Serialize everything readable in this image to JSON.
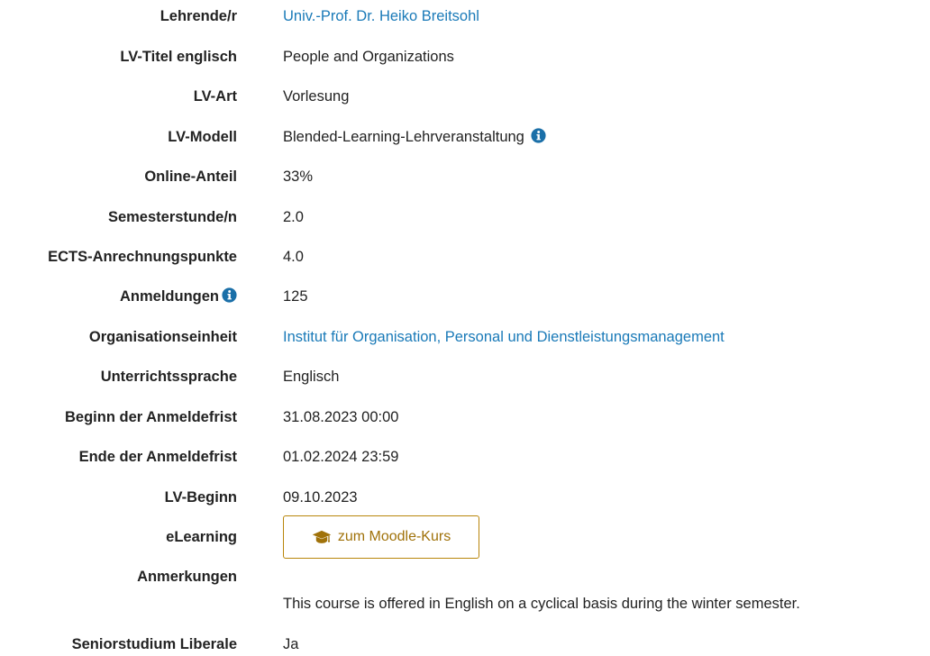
{
  "rows": {
    "lehrende": {
      "label": "Lehrende/r",
      "value": "Univ.-Prof. Dr. Heiko Breitsohl"
    },
    "titel_en": {
      "label": "LV-Titel englisch",
      "value": "People and Organizations"
    },
    "art": {
      "label": "LV-Art",
      "value": "Vorlesung"
    },
    "modell": {
      "label": "LV-Modell",
      "value": "Blended-Learning-Lehrveranstaltung"
    },
    "online": {
      "label": "Online-Anteil",
      "value": "33%"
    },
    "semesterstunden": {
      "label": "Semesterstunde/n",
      "value": "2.0"
    },
    "ects": {
      "label": "ECTS-Anrechnungspunkte",
      "value": "4.0"
    },
    "anmeldungen": {
      "label": "Anmeldungen",
      "value": "125"
    },
    "organisation": {
      "label": "Organisationseinheit",
      "value": "Institut für Organisation, Personal und Dienstleistungsmanagement"
    },
    "sprache": {
      "label": "Unterrichtssprache",
      "value": "Englisch"
    },
    "beginn_frist": {
      "label": "Beginn der Anmeldefrist",
      "value": "31.08.2023 00:00"
    },
    "ende_frist": {
      "label": "Ende der Anmeldefrist",
      "value": "01.02.2024 23:59"
    },
    "lv_beginn": {
      "label": "LV-Beginn",
      "value": "09.10.2023"
    },
    "elearning": {
      "label": "eLearning",
      "button_label": "zum Moodle-Kurs"
    },
    "anmerkungen": {
      "label": "Anmerkungen",
      "value": "This course is offered in English on a cyclical basis during the winter semester."
    },
    "seniorstudium": {
      "label": "Seniorstudium Liberale",
      "value": "Ja"
    }
  },
  "colors": {
    "link": "#1a7ab8",
    "button_border": "#b8860b",
    "button_text": "#a0720a",
    "info_icon": "#1a6fa8"
  },
  "icons": {
    "info": "info-circle-icon",
    "moodle_button": "graduation-cap-icon"
  }
}
